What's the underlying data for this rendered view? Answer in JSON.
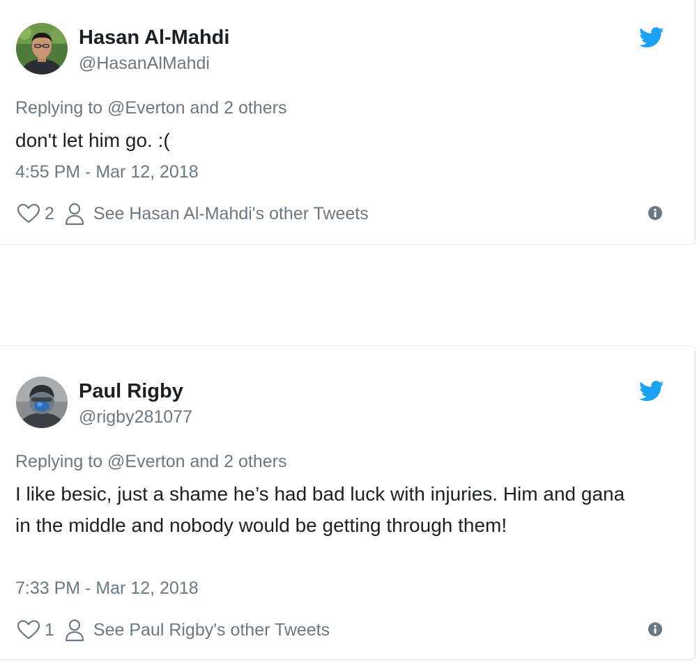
{
  "colors": {
    "twitter_blue": "#1da1f2",
    "meta_gray": "#697882",
    "text_dark": "#1c2022",
    "border": "#e1e8ed"
  },
  "tweets": [
    {
      "name": "Hasan Al-Mahdi",
      "handle": "@HasanAlMahdi",
      "replying": "Replying to @Everton and 2 others",
      "text": "don't let him go. :(",
      "timestamp": "4:55 PM - Mar 12, 2018",
      "likes": "2",
      "other_tweets": "See Hasan Al-Mahdi's other Tweets",
      "icons": [
        "twitter-bird-icon",
        "heart-icon",
        "person-icon",
        "info-icon"
      ]
    },
    {
      "name": "Paul Rigby",
      "handle": "@rigby281077",
      "replying": "Replying to @Everton and 2 others",
      "text": "I like besic, just a shame he’s had bad luck with injuries. Him and gana in the middle and nobody would be getting through them!",
      "timestamp": "7:33 PM - Mar 12, 2018",
      "likes": "1",
      "other_tweets": "See Paul Rigby's other Tweets",
      "icons": [
        "twitter-bird-icon",
        "heart-icon",
        "person-icon",
        "info-icon"
      ]
    }
  ]
}
